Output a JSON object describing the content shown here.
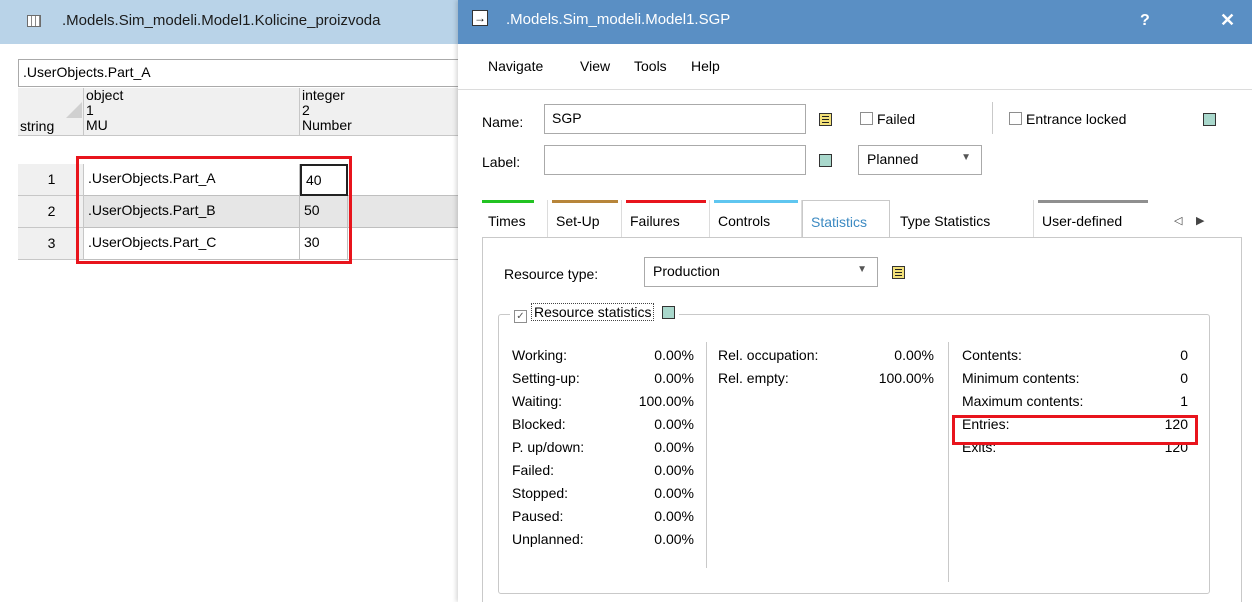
{
  "table_window": {
    "title": ".Models.Sim_modeli.Model1.Kolicine_proizvoda",
    "path_value": ".UserObjects.Part_A",
    "columns": [
      {
        "type": "object",
        "index": "1",
        "name": "MU"
      },
      {
        "type": "integer",
        "index": "2",
        "name": "Number"
      }
    ],
    "row_header_label": "string",
    "rows": [
      {
        "index": "1",
        "object": ".UserObjects.Part_A",
        "number": "40"
      },
      {
        "index": "2",
        "object": ".UserObjects.Part_B",
        "number": "50"
      },
      {
        "index": "3",
        "object": ".UserObjects.Part_C",
        "number": "30"
      }
    ]
  },
  "dialog": {
    "title": ".Models.Sim_modeli.Model1.SGP",
    "help_label": "?",
    "close_label": "✕",
    "menu": [
      "Navigate",
      "View",
      "Tools",
      "Help"
    ],
    "name_label": "Name:",
    "name_value": "SGP",
    "label_label": "Label:",
    "label_value": "",
    "failed_label": "Failed",
    "entrance_locked_label": "Entrance locked",
    "planned_value": "Planned",
    "tabs": [
      {
        "label": "Times",
        "color": "#22c322"
      },
      {
        "label": "Set-Up",
        "color": "#b7853a"
      },
      {
        "label": "Failures",
        "color": "#e8141c"
      },
      {
        "label": "Controls",
        "color": "#5fc6f0"
      },
      {
        "label": "Statistics",
        "color": ""
      },
      {
        "label": "Type Statistics",
        "color": ""
      },
      {
        "label": "User-defined",
        "color": "#8f8f8f"
      }
    ],
    "resource_type_label": "Resource type:",
    "resource_type_value": "Production",
    "resource_statistics_label": "Resource statistics",
    "col1": [
      {
        "label": "Working:",
        "value": "0.00%"
      },
      {
        "label": "Setting-up:",
        "value": "0.00%"
      },
      {
        "label": "Waiting:",
        "value": "100.00%"
      },
      {
        "label": "Blocked:",
        "value": "0.00%"
      },
      {
        "label": "P. up/down:",
        "value": "0.00%"
      },
      {
        "label": "Failed:",
        "value": "0.00%"
      },
      {
        "label": "Stopped:",
        "value": "0.00%"
      },
      {
        "label": "Paused:",
        "value": "0.00%"
      },
      {
        "label": "Unplanned:",
        "value": "0.00%"
      }
    ],
    "col2": [
      {
        "label": "Rel. occupation:",
        "value": "0.00%"
      },
      {
        "label": "Rel. empty:",
        "value": "100.00%"
      }
    ],
    "col3": [
      {
        "label": "Contents:",
        "value": "0"
      },
      {
        "label": "Minimum contents:",
        "value": "0"
      },
      {
        "label": "Maximum contents:",
        "value": "1"
      },
      {
        "label": "Entries:",
        "value": "120"
      },
      {
        "label": "Exits:",
        "value": "120"
      }
    ]
  },
  "colors": {
    "highlight": "#e8141c",
    "title_active": "#5a8fc4",
    "title_inactive": "#b9d3e8",
    "accent_tab": "#3c8ac2"
  }
}
